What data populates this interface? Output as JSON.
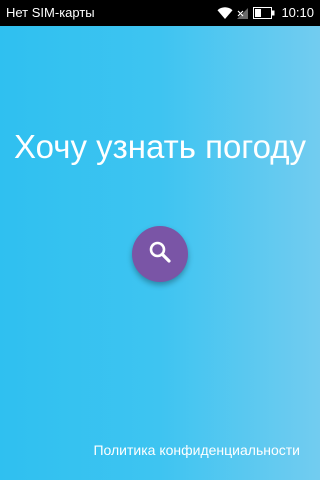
{
  "status_bar": {
    "carrier": "Нет SIM-карты",
    "time": "10:10",
    "icons": [
      "wifi-icon",
      "signal-icon",
      "battery-icon"
    ]
  },
  "main": {
    "title": "Хочу узнать погоду",
    "search_button_icon": "search-icon",
    "privacy_link": "Политика конфиденциальности"
  },
  "colors": {
    "gradient_start": "#2fc0f0",
    "gradient_end": "#72ccf0",
    "fab": "#7a55a6",
    "text": "#ffffff"
  }
}
